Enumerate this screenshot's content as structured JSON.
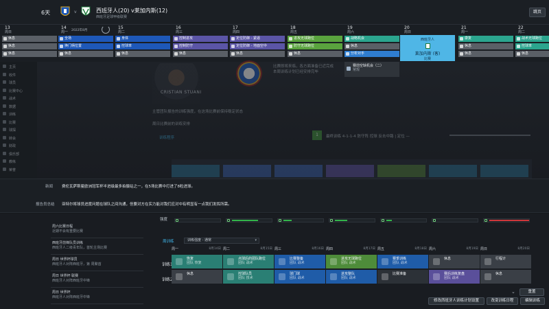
{
  "topbar": {
    "days": "6天",
    "vs": "v",
    "match_title": "西班牙人(20) v莱加内斯(12)",
    "match_sub": "西班牙足球甲级联赛",
    "skip_label": "跳页"
  },
  "calendar": {
    "days": [
      {
        "num": "13",
        "weekday": "周日",
        "slots": [
          {
            "label": "休息",
            "color": "grey"
          },
          {
            "label": "休息",
            "color": "grey"
          },
          {
            "label": "休息",
            "color": "grey"
          }
        ]
      },
      {
        "num": "14",
        "weekday": "周一",
        "month": "2022年8月",
        "slots": [
          {
            "label": "全场",
            "color": "blue"
          },
          {
            "label": "换门柄位置",
            "color": "blue"
          },
          {
            "label": "休息",
            "color": "grey"
          }
        ]
      },
      {
        "num": "15",
        "weekday": "周二",
        "slots": [
          {
            "label": "身体",
            "color": "blue"
          },
          {
            "label": "控球率",
            "color": "blue"
          },
          {
            "label": "休息",
            "color": "grey"
          }
        ]
      },
      {
        "num": "16",
        "weekday": "周三",
        "slots": [
          {
            "label": "控制进攻",
            "color": "purple"
          },
          {
            "label": "控制防守",
            "color": "purple"
          },
          {
            "label": "休息",
            "color": "grey"
          }
        ]
      },
      {
        "num": "17",
        "weekday": "周四",
        "slots": [
          {
            "label": "定位防御 - 紧逼",
            "color": "purple"
          },
          {
            "label": "定位防御 - 地面空中",
            "color": "purple"
          },
          {
            "label": "休息",
            "color": "grey"
          }
        ]
      },
      {
        "num": "18",
        "weekday": "周五",
        "slots": [
          {
            "label": "进攻无球跑位",
            "color": "green"
          },
          {
            "label": "防守无球跑位",
            "color": "green"
          },
          {
            "label": "休息",
            "color": "grey"
          }
        ]
      },
      {
        "num": "19",
        "weekday": "周六",
        "slots": [
          {
            "label": "战略机会",
            "color": "teal"
          },
          {
            "label": "休息",
            "color": "grey"
          },
          {
            "label": "分析对手",
            "color": "sky"
          }
        ]
      },
      {
        "num": "20",
        "weekday": "周日",
        "match": {
          "top": "西班牙人",
          "mid": "莱加内斯 (客)",
          "bottom": "比赛"
        }
      },
      {
        "num": "21",
        "weekday": "周一",
        "slots": [
          {
            "label": "康复",
            "color": "teal"
          },
          {
            "label": "休息",
            "color": "grey"
          },
          {
            "label": "休息",
            "color": "grey"
          }
        ]
      },
      {
        "num": "22",
        "weekday": "周二",
        "slots": [
          {
            "label": "战术无球跑位",
            "color": "teal"
          },
          {
            "label": "控球率",
            "color": "teal"
          },
          {
            "label": "休息",
            "color": "grey"
          }
        ]
      }
    ],
    "extra_slot": {
      "label": "赛前空缺机会（二）",
      "sub": "常规"
    }
  },
  "sidebar": {
    "items": [
      "主页",
      "收件",
      "球员",
      "比赛中心",
      "战术",
      "数据",
      "训练",
      "比赛",
      "球探",
      "转会",
      "财政",
      "俱乐部",
      "教练",
      "荣誉"
    ]
  },
  "background": {
    "player_name": "CRISTIAN STUANI",
    "line1": "比赛即将来临，各方面准备已近完成",
    "line2": "主管团队报告的训练强度，在这场比赛前保持稳定状态",
    "line3": "周日比赛前的训练安排",
    "line4": "本周训练计划已经安排完毕",
    "schedule_title": "训练程序",
    "bar_num": "1",
    "bar_text": "最终训练 4-1-1-4 防守阵 控球 反击中路 | 定位 —"
  },
  "info": {
    "label1": "新闻",
    "text1": "费伦瓦萨斯曼欧洲冠军杯半进级最多拍摄站之一，在5场比赛中打进了8粒进球。",
    "label2": "报告员总结",
    "text2": "亚特尔将球员进度问题在球队之间沟通，但要对方在实力能对我们应对中有明显有一点我们发挥所需。"
  },
  "left_list": [
    {
      "title": "周六比赛日程",
      "sub": "近期不会有重要比赛"
    },
    {
      "title": "西班牙前锋队员训练",
      "sub": "西班牙人二级青年队，首轮主场比赛"
    },
    {
      "title": "周日 世界杯球员",
      "sub": "西班牙人对阵西班牙，第 周聚首"
    },
    {
      "title": "周日 世界杯 联赛",
      "sub": "西班牙人对阵西班牙中锋"
    },
    {
      "title": "周日 世界杯",
      "sub": "西班牙人对阵西班牙中锋"
    }
  ],
  "schedule": {
    "perf_label": "强度",
    "title": "周训练",
    "select_value": "训练强度 - 通常",
    "days": [
      {
        "name": "周一",
        "date": "8月14日"
      },
      {
        "name": "周二",
        "date": "8月15日"
      },
      {
        "name": "周三",
        "date": "8月16日"
      },
      {
        "name": "周四",
        "date": "8月17日"
      },
      {
        "name": "周五",
        "date": "8月18日"
      },
      {
        "name": "周六",
        "date": "8月19日"
      },
      {
        "name": "周日",
        "date": "8月20日"
      }
    ],
    "row1_label": "训练1",
    "row2_label": "训练2",
    "row1": [
      {
        "title": "恢复",
        "sub": "团队 恢复"
      },
      {
        "title": "点球后的团队跑位",
        "sub": "团队 战术"
      },
      {
        "title": "比赛整备",
        "sub": "团队 战术"
      },
      {
        "title": "进攻无球跑位",
        "sub": "团队 战术"
      },
      {
        "title": "赛季训练",
        "sub": "团队 战术"
      },
      {
        "title": "休息",
        "sub": ""
      },
      {
        "title": "行程计",
        "sub": ""
      }
    ],
    "row2": [
      {
        "title": "休息",
        "sub": ""
      },
      {
        "title": "控球队员",
        "sub": "团队 技术"
      },
      {
        "title": "球门球",
        "sub": "团队 战术"
      },
      {
        "title": "进攻整队",
        "sub": "团队 战术"
      },
      {
        "title": "比赛准备",
        "sub": ""
      },
      {
        "title": "赛后训练复盘",
        "sub": "团队 战术"
      },
      {
        "title": "休息",
        "sub": ""
      }
    ]
  },
  "buttons": {
    "reset": "重置",
    "apply_day": "修改西班牙人训练计划设置",
    "clear": "改变训练日程",
    "edit": "编辑训练"
  }
}
